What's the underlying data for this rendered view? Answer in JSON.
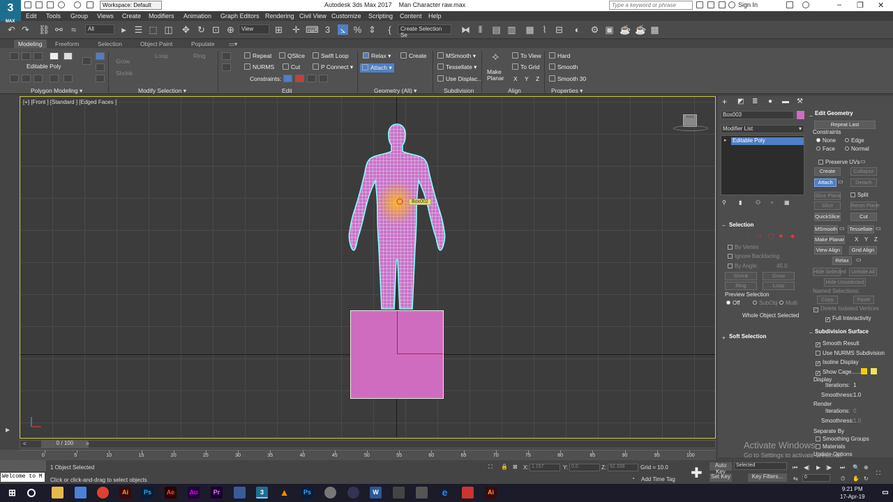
{
  "titlebar": {
    "workspace": "Workspace: Default",
    "app_title": "Autodesk 3ds Max 2017",
    "file_title": "Man Character raw.max",
    "search_placeholder": "Type a keyword or phrase",
    "signin": "Sign In"
  },
  "menu": [
    "Edit",
    "Tools",
    "Group",
    "Views",
    "Create",
    "Modifiers",
    "Animation",
    "Graph Editors",
    "Rendering",
    "Civil View",
    "Customize",
    "Scripting",
    "Content",
    "Help"
  ],
  "toolbar": {
    "filter": "All",
    "refcoord": "View",
    "selection_set": "Create Selection Se"
  },
  "ribbon_tabs": [
    "Modeling",
    "Freeform",
    "Selection",
    "Object Paint",
    "Populate"
  ],
  "ribbon": {
    "editable_poly": "Editable Poly",
    "grow": "Grow",
    "shrink": "Shrink",
    "loop": "Loop",
    "ring": "Ring",
    "repeat": "Repeat",
    "qslice": "QSlice",
    "swift_loop": "Swift Loop",
    "nurms": "NURMS",
    "cut": "Cut",
    "p_connect": "P Connect",
    "constraints": "Constraints:",
    "relax": "Relax",
    "create": "Create",
    "attach": "Attach",
    "msmooth": "MSmooth",
    "tessellate": "Tessellate",
    "use_displace": "Use Displac...",
    "make_planar": "Make Planar",
    "to_view": "To View",
    "to_grid": "To Grid",
    "x": "X",
    "y": "Y",
    "z": "Z",
    "hard": "Hard",
    "smooth": "Smooth",
    "smooth30": "Smooth 30",
    "footer_polygon_modeling": "Polygon Modeling",
    "footer_modify_selection": "Modify Selection",
    "footer_edit": "Edit",
    "footer_geometry": "Geometry (All)",
    "footer_subdivision": "Subdivision",
    "footer_align": "Align",
    "footer_properties": "Properties"
  },
  "viewport": {
    "label": "[+] [Front ] [Standard ] [Edged Faces ]",
    "tooltip": "Box002",
    "cube_label": "front"
  },
  "command_panel": {
    "object_name": "Box003",
    "modifier_list": "Modifier List",
    "stack_item": "Editable Poly",
    "selection_title": "Selection",
    "by_vertex": "By Vertex",
    "ignore_backfacing": "Ignore Backfacing",
    "by_angle": "By Angle:",
    "by_angle_value": "45.0",
    "shrink": "Shrink",
    "grow": "Grow",
    "ring": "Ring",
    "loop": "Loop",
    "preview_selection": "Preview Selection",
    "off": "Off",
    "subobj": "SubObj",
    "multi": "Multi",
    "whole_object": "Whole Object Selected",
    "soft_selection": "Soft Selection",
    "edit_geometry": "Edit Geometry",
    "repeat_last": "Repeat Last",
    "constraints": "Constraints",
    "none": "None",
    "edge": "Edge",
    "face": "Face",
    "normal": "Normal",
    "preserve_uvs": "Preserve UVs",
    "create": "Create",
    "collapse": "Collapse",
    "attach": "Attach",
    "detach": "Detach",
    "slice_plane": "Slice Plane",
    "split": "Split",
    "slice": "Slice",
    "reset_plane": "Reset Plane",
    "quickslice": "QuickSlice",
    "cut": "Cut",
    "msmooth": "MSmooth",
    "tessellate": "Tessellate",
    "make_planar": "Make Planar",
    "x": "X",
    "y": "Y",
    "z": "Z",
    "view_align": "View Align",
    "grid_align": "Grid Align",
    "relax": "Relax",
    "hide_selected": "Hide Selected",
    "unhide_all": "Unhide All",
    "hide_unselected": "Hide Unselected",
    "named_selections": "Named Selections:",
    "copy": "Copy",
    "paste": "Paste",
    "delete_isolated": "Delete Isolated Vertices",
    "full_interactivity": "Full Interactivity",
    "subdivision_surface": "Subdivision Surface",
    "smooth_result": "Smooth Result",
    "use_nurms": "Use NURMS Subdivision",
    "isoline": "Isoline Display",
    "show_cage": "Show Cage......",
    "display": "Display",
    "iterations": "Iterations:",
    "iterations_val": "1",
    "smoothness": "Smoothness:",
    "smoothness_val": "1.0",
    "render": "Render",
    "r_iterations_val": "0",
    "r_smoothness_val": "1.0",
    "separate_by": "Separate By",
    "smoothing_groups": "Smoothing Groups",
    "materials": "Materials",
    "update_options": "Update Options"
  },
  "timeline": {
    "frame": "0 / 100",
    "ticks": [
      "0",
      "5",
      "10",
      "15",
      "20",
      "25",
      "30",
      "35",
      "40",
      "45",
      "50",
      "55",
      "60",
      "65",
      "70",
      "75",
      "80",
      "85",
      "90",
      "95",
      "100"
    ]
  },
  "status": {
    "objects_selected": "1 Object Selected",
    "prompt": "Click or click-and-drag to select objects",
    "welcome": "Welcome to M",
    "x_label": "X:",
    "x_val": "1.157",
    "y_label": "Y:",
    "y_val": "0.0",
    "z_label": "Z:",
    "z_val": "62.339",
    "grid": "Grid = 10.0",
    "add_time_tag": "Add Time Tag",
    "auto_key": "Auto Key",
    "selected": "Selected",
    "set_key": "Set Key",
    "key_filters": "Key Filters...",
    "frame_val": "0"
  },
  "watermark": {
    "line1": "Activate Windows",
    "line2": "Go to Settings to activate Windows."
  },
  "taskbar": {
    "time": "9:21 PM",
    "date": "17-Apr-19"
  },
  "colors": {
    "accent_blue": "#4f7fc6",
    "object_pink": "#d06cc0",
    "wire_cyan": "#9ff"
  }
}
